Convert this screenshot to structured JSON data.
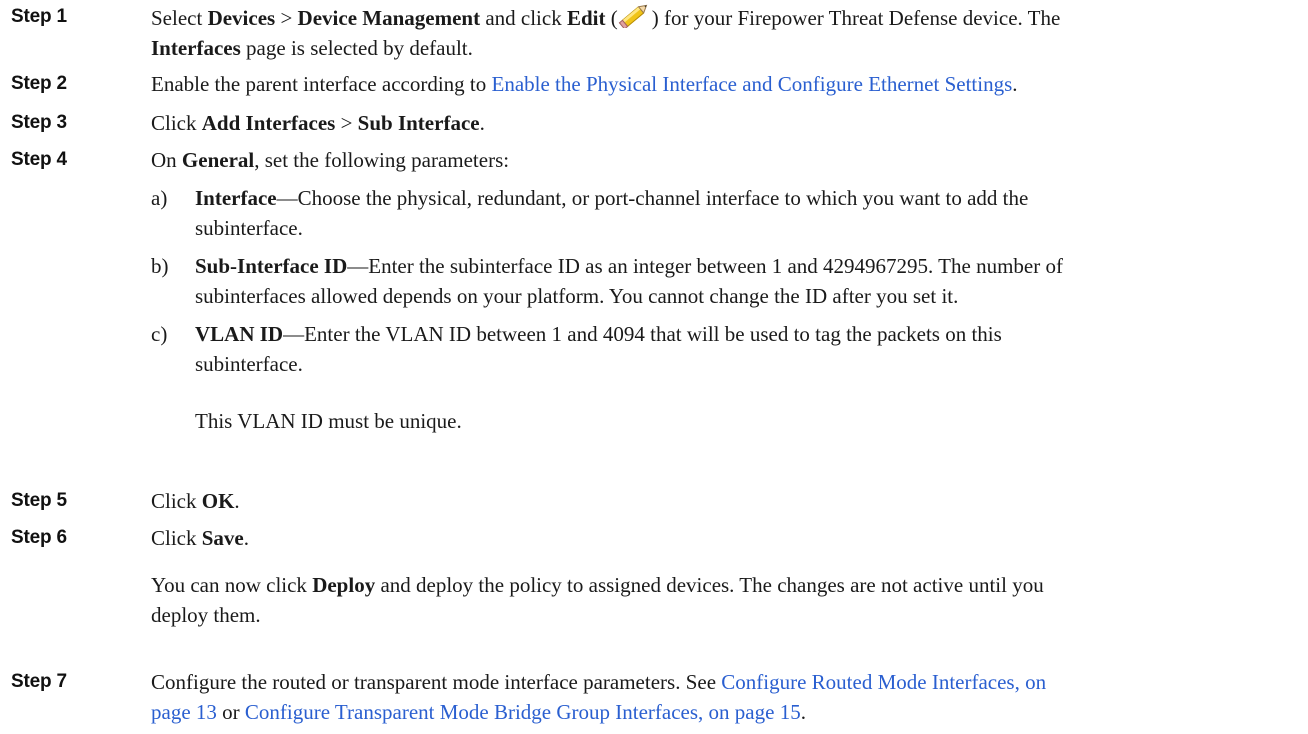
{
  "steps": [
    {
      "label": "Step 1",
      "t1": "Select ",
      "b1": "Devices",
      "t2": " > ",
      "b2": "Device Management",
      "t3": " and click ",
      "b3": "Edit",
      "t4": " (",
      "t5": ") for your Firepower Threat Defense device. The",
      "b4": "Interfaces",
      "t6": " page is selected by default.",
      "icon": "pencil-icon"
    },
    {
      "label": "Step 2",
      "t1": "Enable the parent interface according to ",
      "link": "Enable the Physical Interface and Configure Ethernet Settings",
      "t2": "."
    },
    {
      "label": "Step 3",
      "t1": "Click ",
      "b1": "Add Interfaces",
      "t2": " > ",
      "b2": "Sub Interface",
      "t3": "."
    },
    {
      "label": "Step 4",
      "t1": "On ",
      "b1": "General",
      "t2": ", set the following parameters:",
      "substeps": [
        {
          "letter": "a)",
          "b": "Interface",
          "line1": "—Choose the physical, redundant, or port-channel interface to which you want to add the",
          "line2": "subinterface."
        },
        {
          "letter": "b)",
          "b": "Sub-Interface ID",
          "line1": "—Enter the subinterface ID as an integer between 1 and 4294967295. The number of",
          "line2": "subinterfaces allowed depends on your platform. You cannot change the ID after you set it."
        },
        {
          "letter": "c)",
          "b": "VLAN ID",
          "line1": "—Enter the VLAN ID between 1 and 4094 that will be used to tag the packets on this",
          "line2": "subinterface."
        }
      ],
      "note": "This VLAN ID must be unique."
    },
    {
      "label": "Step 5",
      "t1": "Click ",
      "b1": "OK",
      "t2": "."
    },
    {
      "label": "Step 6",
      "t1": "Click ",
      "b1": "Save",
      "t2": ".",
      "para_t1": "You can now click ",
      "para_b1": "Deploy",
      "para_t2": " and deploy the policy to assigned devices. The changes are not active until you",
      "para_line2": "deploy them."
    },
    {
      "label": "Step 7",
      "t1": "Configure the routed or transparent mode interface parameters. See ",
      "link1a": "Configure Routed Mode Interfaces, on",
      "link1b": "page 13",
      "t2": " or ",
      "link2": "Configure Transparent Mode Bridge Group Interfaces, on page 15",
      "t3": "."
    }
  ],
  "colors": {
    "link": "#2a5fd0",
    "text": "#1a1a1a"
  }
}
